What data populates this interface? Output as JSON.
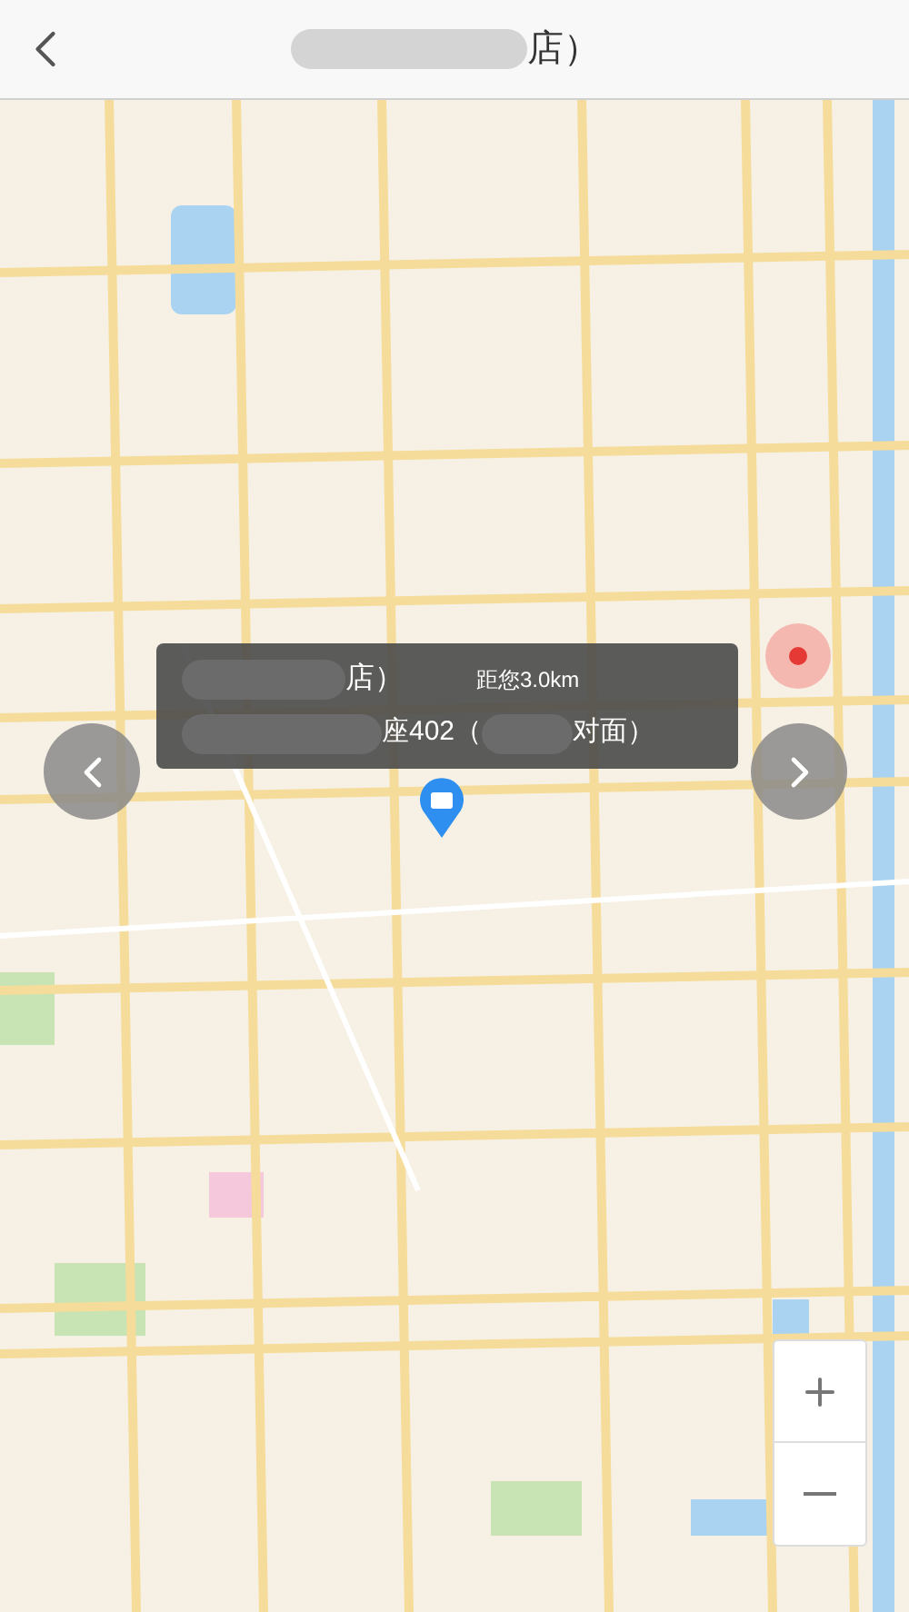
{
  "header": {
    "title": "店）"
  },
  "info_popup": {
    "name": "店）",
    "distance": "距您3.0km",
    "address": "座402（",
    "address_end": "对面）"
  }
}
